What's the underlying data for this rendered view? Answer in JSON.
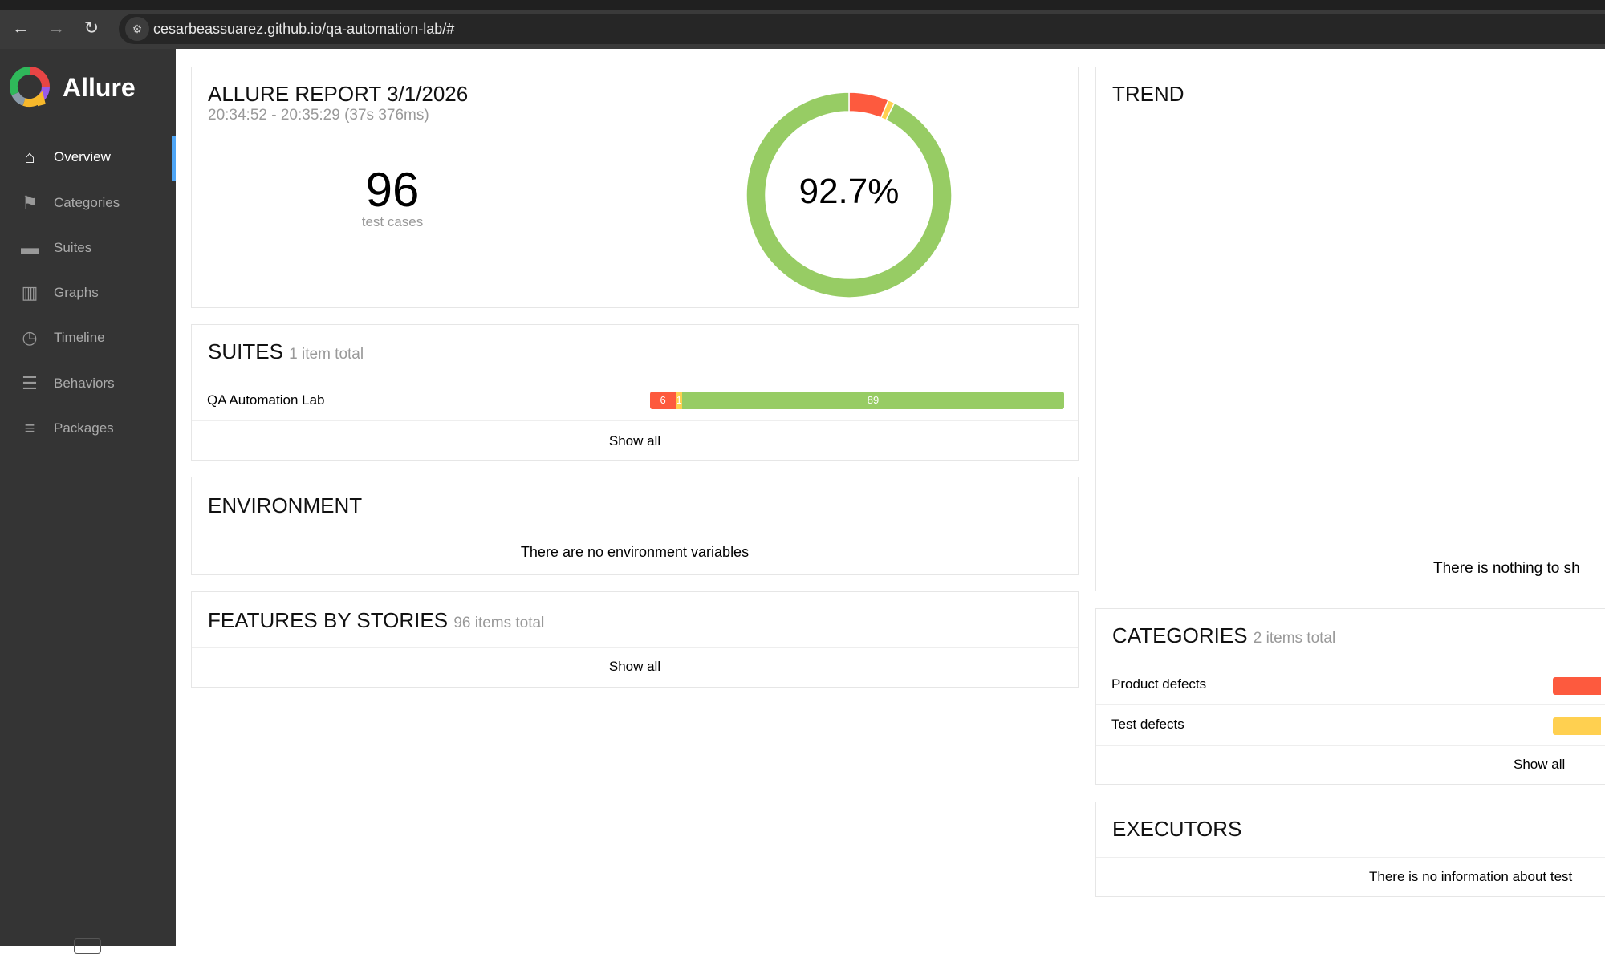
{
  "browser": {
    "url": "cesarbeassuarez.github.io/qa-automation-lab/#",
    "back_icon": "arrow-left",
    "forward_icon": "arrow-right",
    "reload_icon": "reload"
  },
  "sidebar": {
    "brand": "Allure",
    "items": [
      {
        "label": "Overview",
        "icon": "home",
        "active": true
      },
      {
        "label": "Categories",
        "icon": "flag"
      },
      {
        "label": "Suites",
        "icon": "briefcase"
      },
      {
        "label": "Graphs",
        "icon": "bar-chart"
      },
      {
        "label": "Timeline",
        "icon": "clock"
      },
      {
        "label": "Behaviors",
        "icon": "list"
      },
      {
        "label": "Packages",
        "icon": "align-left"
      }
    ]
  },
  "summary": {
    "title": "ALLURE REPORT 3/1/2026",
    "time": "20:34:52 - 20:35:29 (37s 376ms)",
    "count": "96",
    "count_label": "test cases",
    "percent": "92.7%",
    "donut": {
      "failed": 6,
      "broken": 1,
      "passed": 89
    }
  },
  "colors": {
    "failed": "#fd5a3e",
    "broken": "#ffd050",
    "passed": "#97cc64",
    "accent": "#4ea5f5"
  },
  "suites": {
    "title": "SUITES",
    "subtitle": "1 item total",
    "rows": [
      {
        "name": "QA Automation Lab",
        "failed": "6",
        "broken": "1",
        "passed": "89"
      }
    ],
    "show_all": "Show all"
  },
  "environment": {
    "title": "ENVIRONMENT",
    "empty": "There are no environment variables"
  },
  "features": {
    "title": "FEATURES BY STORIES",
    "subtitle": "96 items total",
    "show_all": "Show all"
  },
  "trend": {
    "title": "TREND",
    "empty": "There is nothing to sh"
  },
  "categories": {
    "title": "CATEGORIES",
    "subtitle": "2 items total",
    "rows": [
      {
        "name": "Product defects"
      },
      {
        "name": "Test defects"
      }
    ],
    "show_all": "Show all"
  },
  "executors": {
    "title": "EXECUTORS",
    "empty": "There is no information about test"
  }
}
